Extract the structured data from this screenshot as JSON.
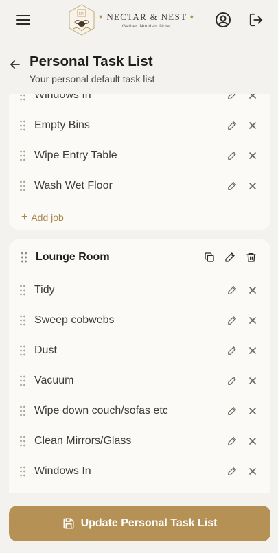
{
  "header": {
    "brand_title": "NECTAR & NEST",
    "brand_tagline": "Gather. Nourish. Note.",
    "icons": [
      "menu-icon",
      "user-circle-icon",
      "logout-icon"
    ]
  },
  "page": {
    "title": "Personal Task List",
    "subtitle": "Your personal default task list"
  },
  "sections": [
    {
      "tasks": [
        "Windows In",
        "Empty Bins",
        "Wipe Entry Table",
        "Wash Wet Floor"
      ],
      "add_job_label": "Add job"
    },
    {
      "title": "Lounge Room",
      "tasks": [
        "Tidy",
        "Sweep cobwebs",
        "Dust",
        "Vacuum",
        "Wipe down couch/sofas etc",
        "Clean Mirrors/Glass",
        "Windows In"
      ]
    }
  ],
  "footer": {
    "update_label": "Update Personal Task List"
  },
  "colors": {
    "accent": "#b69156",
    "background": "#f3f2ee",
    "card": "#fbfaf7"
  }
}
